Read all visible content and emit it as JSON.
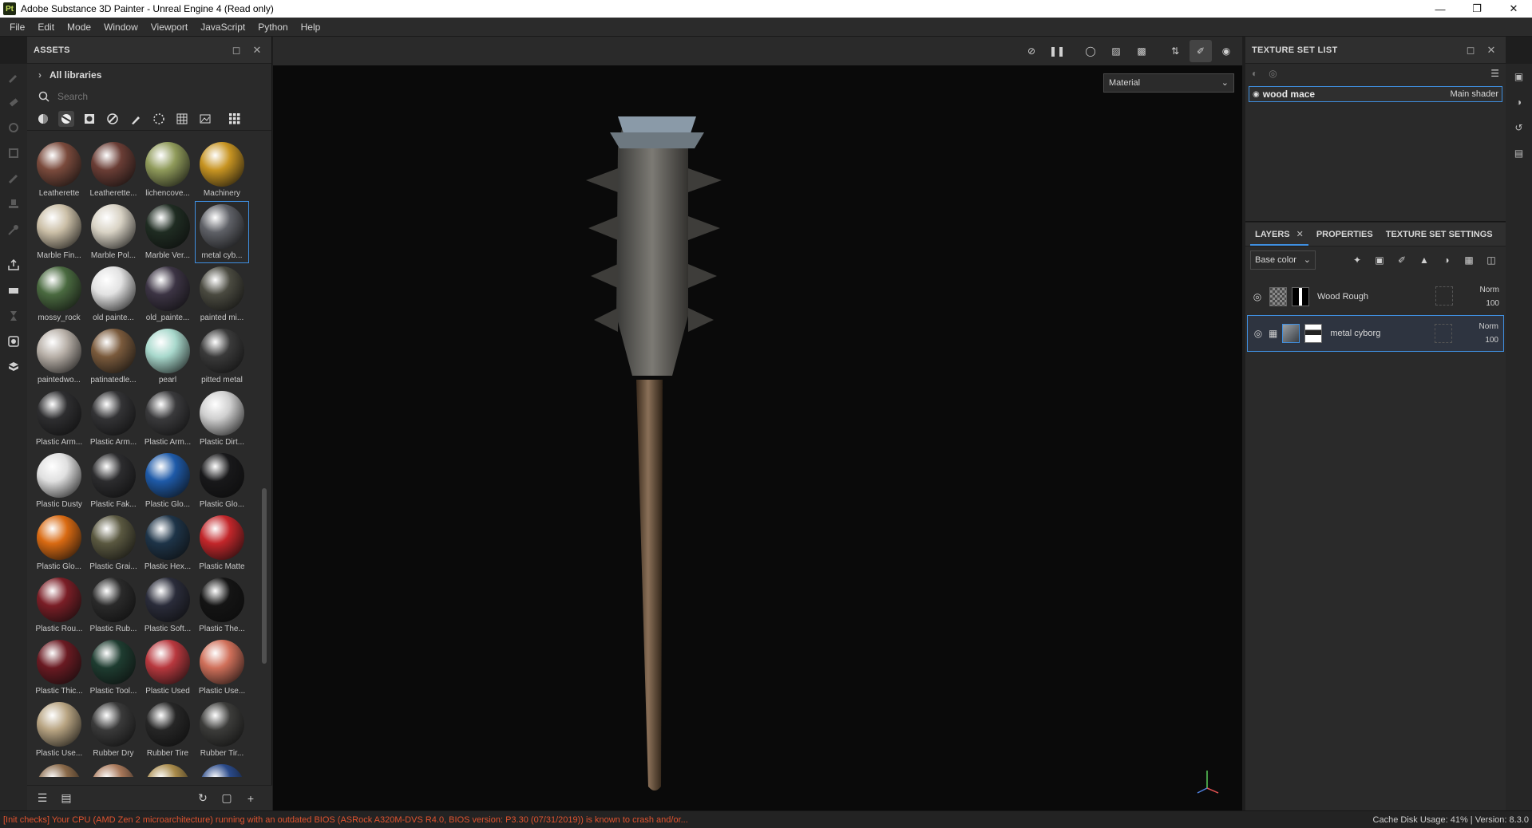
{
  "window": {
    "title": "Adobe Substance 3D Painter - Unreal Engine 4 (Read only)",
    "app_badge": "Pt"
  },
  "menu": [
    "File",
    "Edit",
    "Mode",
    "Window",
    "Viewport",
    "JavaScript",
    "Python",
    "Help"
  ],
  "assets": {
    "title": "ASSETS",
    "library": "All libraries",
    "search_placeholder": "Search",
    "items": [
      {
        "label": "Leatherette",
        "color": "#7a4a3c"
      },
      {
        "label": "Leatherette...",
        "color": "#6a3d35"
      },
      {
        "label": "lichencove...",
        "color": "#8f9a5a"
      },
      {
        "label": "Machinery",
        "color": "#c79422"
      },
      {
        "label": "Marble Fin...",
        "color": "#cbbfa7"
      },
      {
        "label": "Marble Pol...",
        "color": "#d8d2c4"
      },
      {
        "label": "Marble Ver...",
        "color": "#1f2c22"
      },
      {
        "label": "metal cyb...",
        "color": "#5e6066",
        "selected": true
      },
      {
        "label": "mossy_rock",
        "color": "#4a6a40"
      },
      {
        "label": "old painte...",
        "color": "#e2e2e2"
      },
      {
        "label": "old_painte...",
        "color": "#3c3444"
      },
      {
        "label": "painted mi...",
        "color": "#4a4a40"
      },
      {
        "label": "paintedwo...",
        "color": "#b8b0a8"
      },
      {
        "label": "patinatedle...",
        "color": "#7a5a3c"
      },
      {
        "label": "pearl",
        "color": "#a8d8cc"
      },
      {
        "label": "pitted metal",
        "color": "#3a3a3a"
      },
      {
        "label": "Plastic Arm...",
        "color": "#2e2e30"
      },
      {
        "label": "Plastic Arm...",
        "color": "#333335"
      },
      {
        "label": "Plastic Arm...",
        "color": "#3a3a3c"
      },
      {
        "label": "Plastic Dirt...",
        "color": "#cfcfcf"
      },
      {
        "label": "Plastic Dusty",
        "color": "#e0e0e0"
      },
      {
        "label": "Plastic Fak...",
        "color": "#2c2c2e"
      },
      {
        "label": "Plastic Glo...",
        "color": "#1e5aa8"
      },
      {
        "label": "Plastic Glo...",
        "color": "#18181a"
      },
      {
        "label": "Plastic Glo...",
        "color": "#d96a12"
      },
      {
        "label": "Plastic Grai...",
        "color": "#5a5840"
      },
      {
        "label": "Plastic Hex...",
        "color": "#1e3448"
      },
      {
        "label": "Plastic Matte",
        "color": "#c2262a"
      },
      {
        "label": "Plastic Rou...",
        "color": "#7a1e26"
      },
      {
        "label": "Plastic Rub...",
        "color": "#2a2a2a"
      },
      {
        "label": "Plastic Soft...",
        "color": "#2a2c3a"
      },
      {
        "label": "Plastic The...",
        "color": "#141414"
      },
      {
        "label": "Plastic Thic...",
        "color": "#6a1a22"
      },
      {
        "label": "Plastic Tool...",
        "color": "#1e3c30"
      },
      {
        "label": "Plastic Used",
        "color": "#b8383e"
      },
      {
        "label": "Plastic Use...",
        "color": "#d0705a"
      },
      {
        "label": "Plastic Use...",
        "color": "#b8a482"
      },
      {
        "label": "Rubber Dry",
        "color": "#3a3a3a"
      },
      {
        "label": "Rubber Tire",
        "color": "#262626"
      },
      {
        "label": "Rubber Tir...",
        "color": "#3c3c3a"
      },
      {
        "label": "",
        "color": "#8a6a4a"
      },
      {
        "label": "",
        "color": "#a8785a"
      },
      {
        "label": "",
        "color": "#a88a4a"
      },
      {
        "label": "",
        "color": "#2a4a8a"
      }
    ]
  },
  "viewport": {
    "display_mode": "Material"
  },
  "texture_set_list": {
    "title": "TEXTURE SET LIST",
    "item_name": "wood mace",
    "item_shader": "Main shader"
  },
  "layers_panel": {
    "tabs": [
      {
        "label": "LAYERS",
        "active": true
      },
      {
        "label": "PROPERTIES"
      },
      {
        "label": "TEXTURE SET SETTINGS"
      }
    ],
    "channel": "Base color",
    "layers": [
      {
        "name": "Wood Rough",
        "blend": "Norm",
        "opacity": "100"
      },
      {
        "name": "metal cyborg",
        "blend": "Norm",
        "opacity": "100"
      }
    ]
  },
  "status": {
    "warning": "[Init checks] Your CPU (AMD Zen 2 microarchitecture) running with an outdated BIOS (ASRock A320M-DVS R4.0, BIOS version: P3.30 (07/31/2019)) is known to crash and/or...",
    "cache": "Cache Disk Usage:   41% | Version: 8.3.0"
  }
}
